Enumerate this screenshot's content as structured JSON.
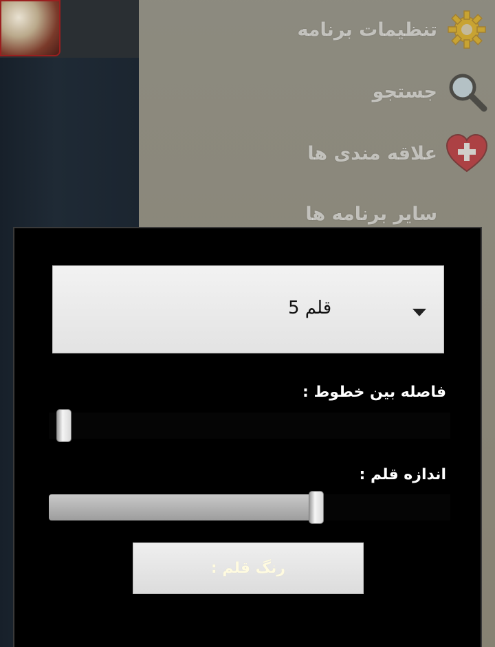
{
  "drawer": {
    "items": [
      {
        "label": "تنظیمات برنامه",
        "icon": "gear-icon"
      },
      {
        "label": "جستجو",
        "icon": "search-icon"
      },
      {
        "label": "علاقه مندی ها",
        "icon": "heart-plus-icon"
      },
      {
        "label": "سایر برنامه ها",
        "icon": ""
      }
    ]
  },
  "dialog": {
    "font_select": {
      "selected": "قلم 5"
    },
    "line_spacing": {
      "label": "فاصله بین خطوط :",
      "value": 0.0
    },
    "font_size": {
      "label": "اندازه قلم :",
      "value": 0.66
    },
    "font_color_button": {
      "label": "رنگ قلم :"
    }
  },
  "colors": {
    "dialog_bg": "#000000",
    "label_text": "#ffffff",
    "menu_text": "#ffffff"
  }
}
